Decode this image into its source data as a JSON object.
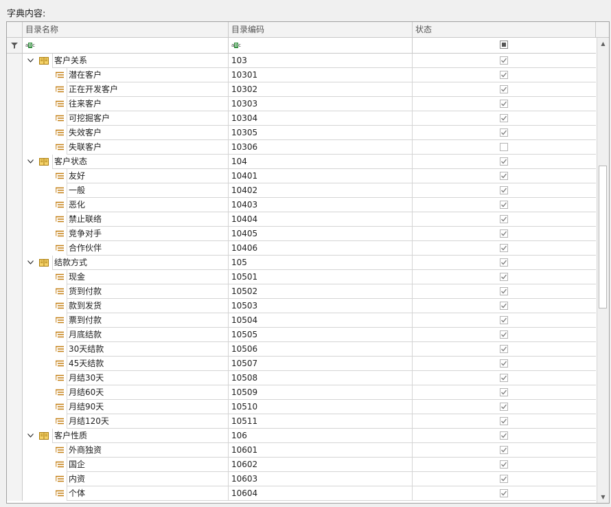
{
  "title": "字典内容:",
  "columns": {
    "name": "目录名称",
    "code": "目录编码",
    "status": "状态"
  },
  "colors": {
    "book": "#d4a017",
    "leaf": "#c27c0e",
    "grid_line": "#d4d4d4"
  },
  "icons": {
    "filter": "funnel-icon",
    "text_filter": "abc-icon",
    "group": "book-icon",
    "item": "list-item-icon",
    "expand": "chevron-down-icon"
  },
  "filter_row": {
    "text_icon_left": "a",
    "text_icon_mid": "B",
    "text_icon_right": "c"
  },
  "rows": [
    {
      "type": "group",
      "name": "客户关系",
      "code": "103",
      "checked": true
    },
    {
      "type": "item",
      "name": "潜在客户",
      "code": "10301",
      "checked": true
    },
    {
      "type": "item",
      "name": "正在开发客户",
      "code": "10302",
      "checked": true
    },
    {
      "type": "item",
      "name": "往来客户",
      "code": "10303",
      "checked": true
    },
    {
      "type": "item",
      "name": "可挖掘客户",
      "code": "10304",
      "checked": true
    },
    {
      "type": "item",
      "name": "失效客户",
      "code": "10305",
      "checked": true
    },
    {
      "type": "item",
      "name": "失联客户",
      "code": "10306",
      "checked": false
    },
    {
      "type": "group",
      "name": "客户状态",
      "code": "104",
      "checked": true
    },
    {
      "type": "item",
      "name": "友好",
      "code": "10401",
      "checked": true
    },
    {
      "type": "item",
      "name": "一般",
      "code": "10402",
      "checked": true
    },
    {
      "type": "item",
      "name": "恶化",
      "code": "10403",
      "checked": true
    },
    {
      "type": "item",
      "name": "禁止联络",
      "code": "10404",
      "checked": true
    },
    {
      "type": "item",
      "name": "竞争对手",
      "code": "10405",
      "checked": true
    },
    {
      "type": "item",
      "name": "合作伙伴",
      "code": "10406",
      "checked": true
    },
    {
      "type": "group",
      "name": "结款方式",
      "code": "105",
      "checked": true
    },
    {
      "type": "item",
      "name": "现金",
      "code": "10501",
      "checked": true
    },
    {
      "type": "item",
      "name": "货到付款",
      "code": "10502",
      "checked": true
    },
    {
      "type": "item",
      "name": "款到发货",
      "code": "10503",
      "checked": true
    },
    {
      "type": "item",
      "name": "票到付款",
      "code": "10504",
      "checked": true
    },
    {
      "type": "item",
      "name": "月底结款",
      "code": "10505",
      "checked": true
    },
    {
      "type": "item",
      "name": "30天结款",
      "code": "10506",
      "checked": true
    },
    {
      "type": "item",
      "name": "45天结款",
      "code": "10507",
      "checked": true
    },
    {
      "type": "item",
      "name": "月结30天",
      "code": "10508",
      "checked": true
    },
    {
      "type": "item",
      "name": "月结60天",
      "code": "10509",
      "checked": true
    },
    {
      "type": "item",
      "name": "月结90天",
      "code": "10510",
      "checked": true
    },
    {
      "type": "item",
      "name": "月结120天",
      "code": "10511",
      "checked": true
    },
    {
      "type": "group",
      "name": "客户性质",
      "code": "106",
      "checked": true
    },
    {
      "type": "item",
      "name": "外商独资",
      "code": "10601",
      "checked": true
    },
    {
      "type": "item",
      "name": "国企",
      "code": "10602",
      "checked": true
    },
    {
      "type": "item",
      "name": "内资",
      "code": "10603",
      "checked": true
    },
    {
      "type": "item",
      "name": "个体",
      "code": "10604",
      "checked": true
    }
  ]
}
